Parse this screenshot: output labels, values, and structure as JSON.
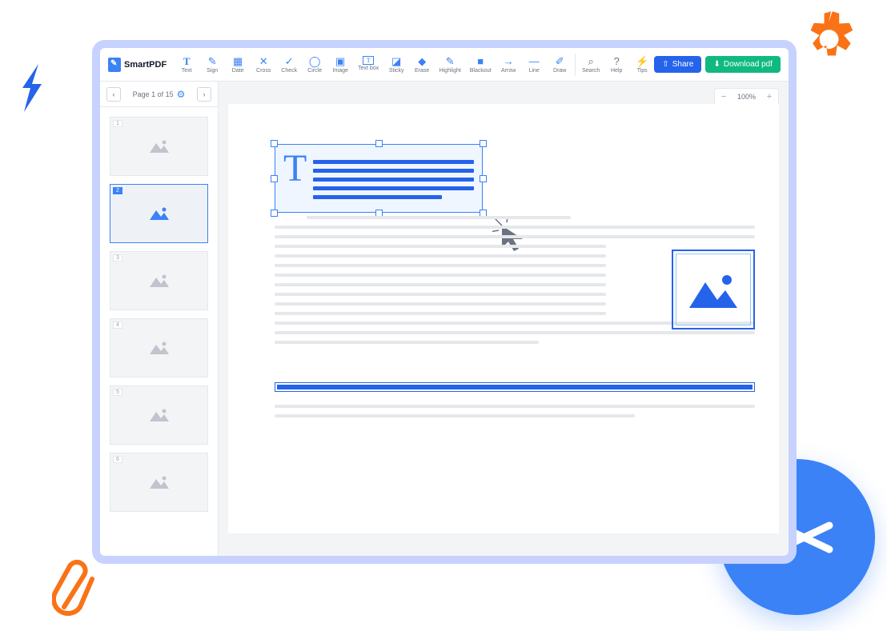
{
  "logo": {
    "text": "SmartPDF"
  },
  "tools": [
    {
      "label": "Text",
      "icon": "T"
    },
    {
      "label": "Sign",
      "icon": "✎"
    },
    {
      "label": "Date",
      "icon": "▦"
    },
    {
      "label": "Cross",
      "icon": "✕"
    },
    {
      "label": "Check",
      "icon": "✓"
    },
    {
      "label": "Circle",
      "icon": "◯"
    },
    {
      "label": "Image",
      "icon": "▣"
    },
    {
      "label": "Text box",
      "icon": "T"
    },
    {
      "label": "Sticky",
      "icon": "◪"
    },
    {
      "label": "Erase",
      "icon": "◆"
    },
    {
      "label": "Highlight",
      "icon": "✎"
    },
    {
      "label": "Blackout",
      "icon": "■"
    },
    {
      "label": "Arrow",
      "icon": "→"
    },
    {
      "label": "Line",
      "icon": "—"
    },
    {
      "label": "Draw",
      "icon": "✐"
    }
  ],
  "right_tools": [
    {
      "label": "Search",
      "icon": "⌕"
    },
    {
      "label": "Help",
      "icon": "?"
    },
    {
      "label": "Tips",
      "icon": "⚡"
    }
  ],
  "buttons": {
    "share": "Share",
    "download": "Download pdf"
  },
  "pager": {
    "text": "Page 1 of 15"
  },
  "thumbs": [
    "1",
    "2",
    "3",
    "4",
    "5",
    "6"
  ],
  "active_thumb": "2",
  "zoom": "100%"
}
